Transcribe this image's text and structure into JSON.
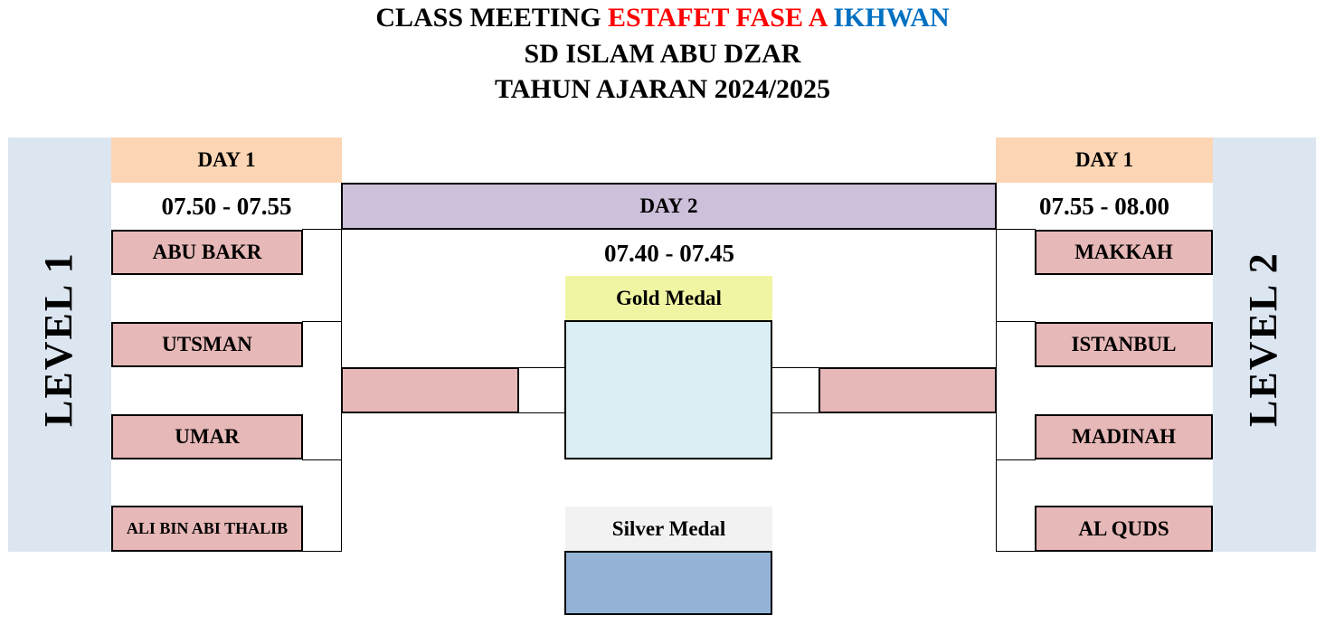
{
  "title": {
    "line1_part1": "CLASS MEETING",
    "line1_part2": "ESTAFET FASE A",
    "line1_part3": "IKHWAN",
    "line2": "SD ISLAM ABU DZAR",
    "line3": "TAHUN AJARAN 2024/2025"
  },
  "left": {
    "level": "LEVEL 1",
    "day_label": "DAY 1",
    "time": "07.50 - 07.55",
    "teams": [
      "ABU BAKR",
      "UTSMAN",
      "UMAR",
      "ALI BIN ABI THALIB"
    ]
  },
  "right": {
    "level": "LEVEL 2",
    "day_label": "DAY 1",
    "time": "07.55 - 08.00",
    "teams": [
      "MAKKAH",
      "ISTANBUL",
      "MADINAH",
      "AL QUDS"
    ]
  },
  "center": {
    "day_label": "DAY 2",
    "time": "07.40 - 07.45",
    "gold_label": "Gold Medal",
    "silver_label": "Silver Medal"
  },
  "colors": {
    "title_red": "#ff0000",
    "title_blue": "#0070c0",
    "level_bg": "#dce6f1",
    "day1_bg": "#fcd5b4",
    "day2_bg": "#ccc0da",
    "team_bg": "#e6b8b7",
    "gold_label_bg": "#f0f5a3",
    "gold_box_bg": "#daeef3",
    "silver_label_bg": "#f2f2f2",
    "silver_box_bg": "#95b3d7"
  }
}
